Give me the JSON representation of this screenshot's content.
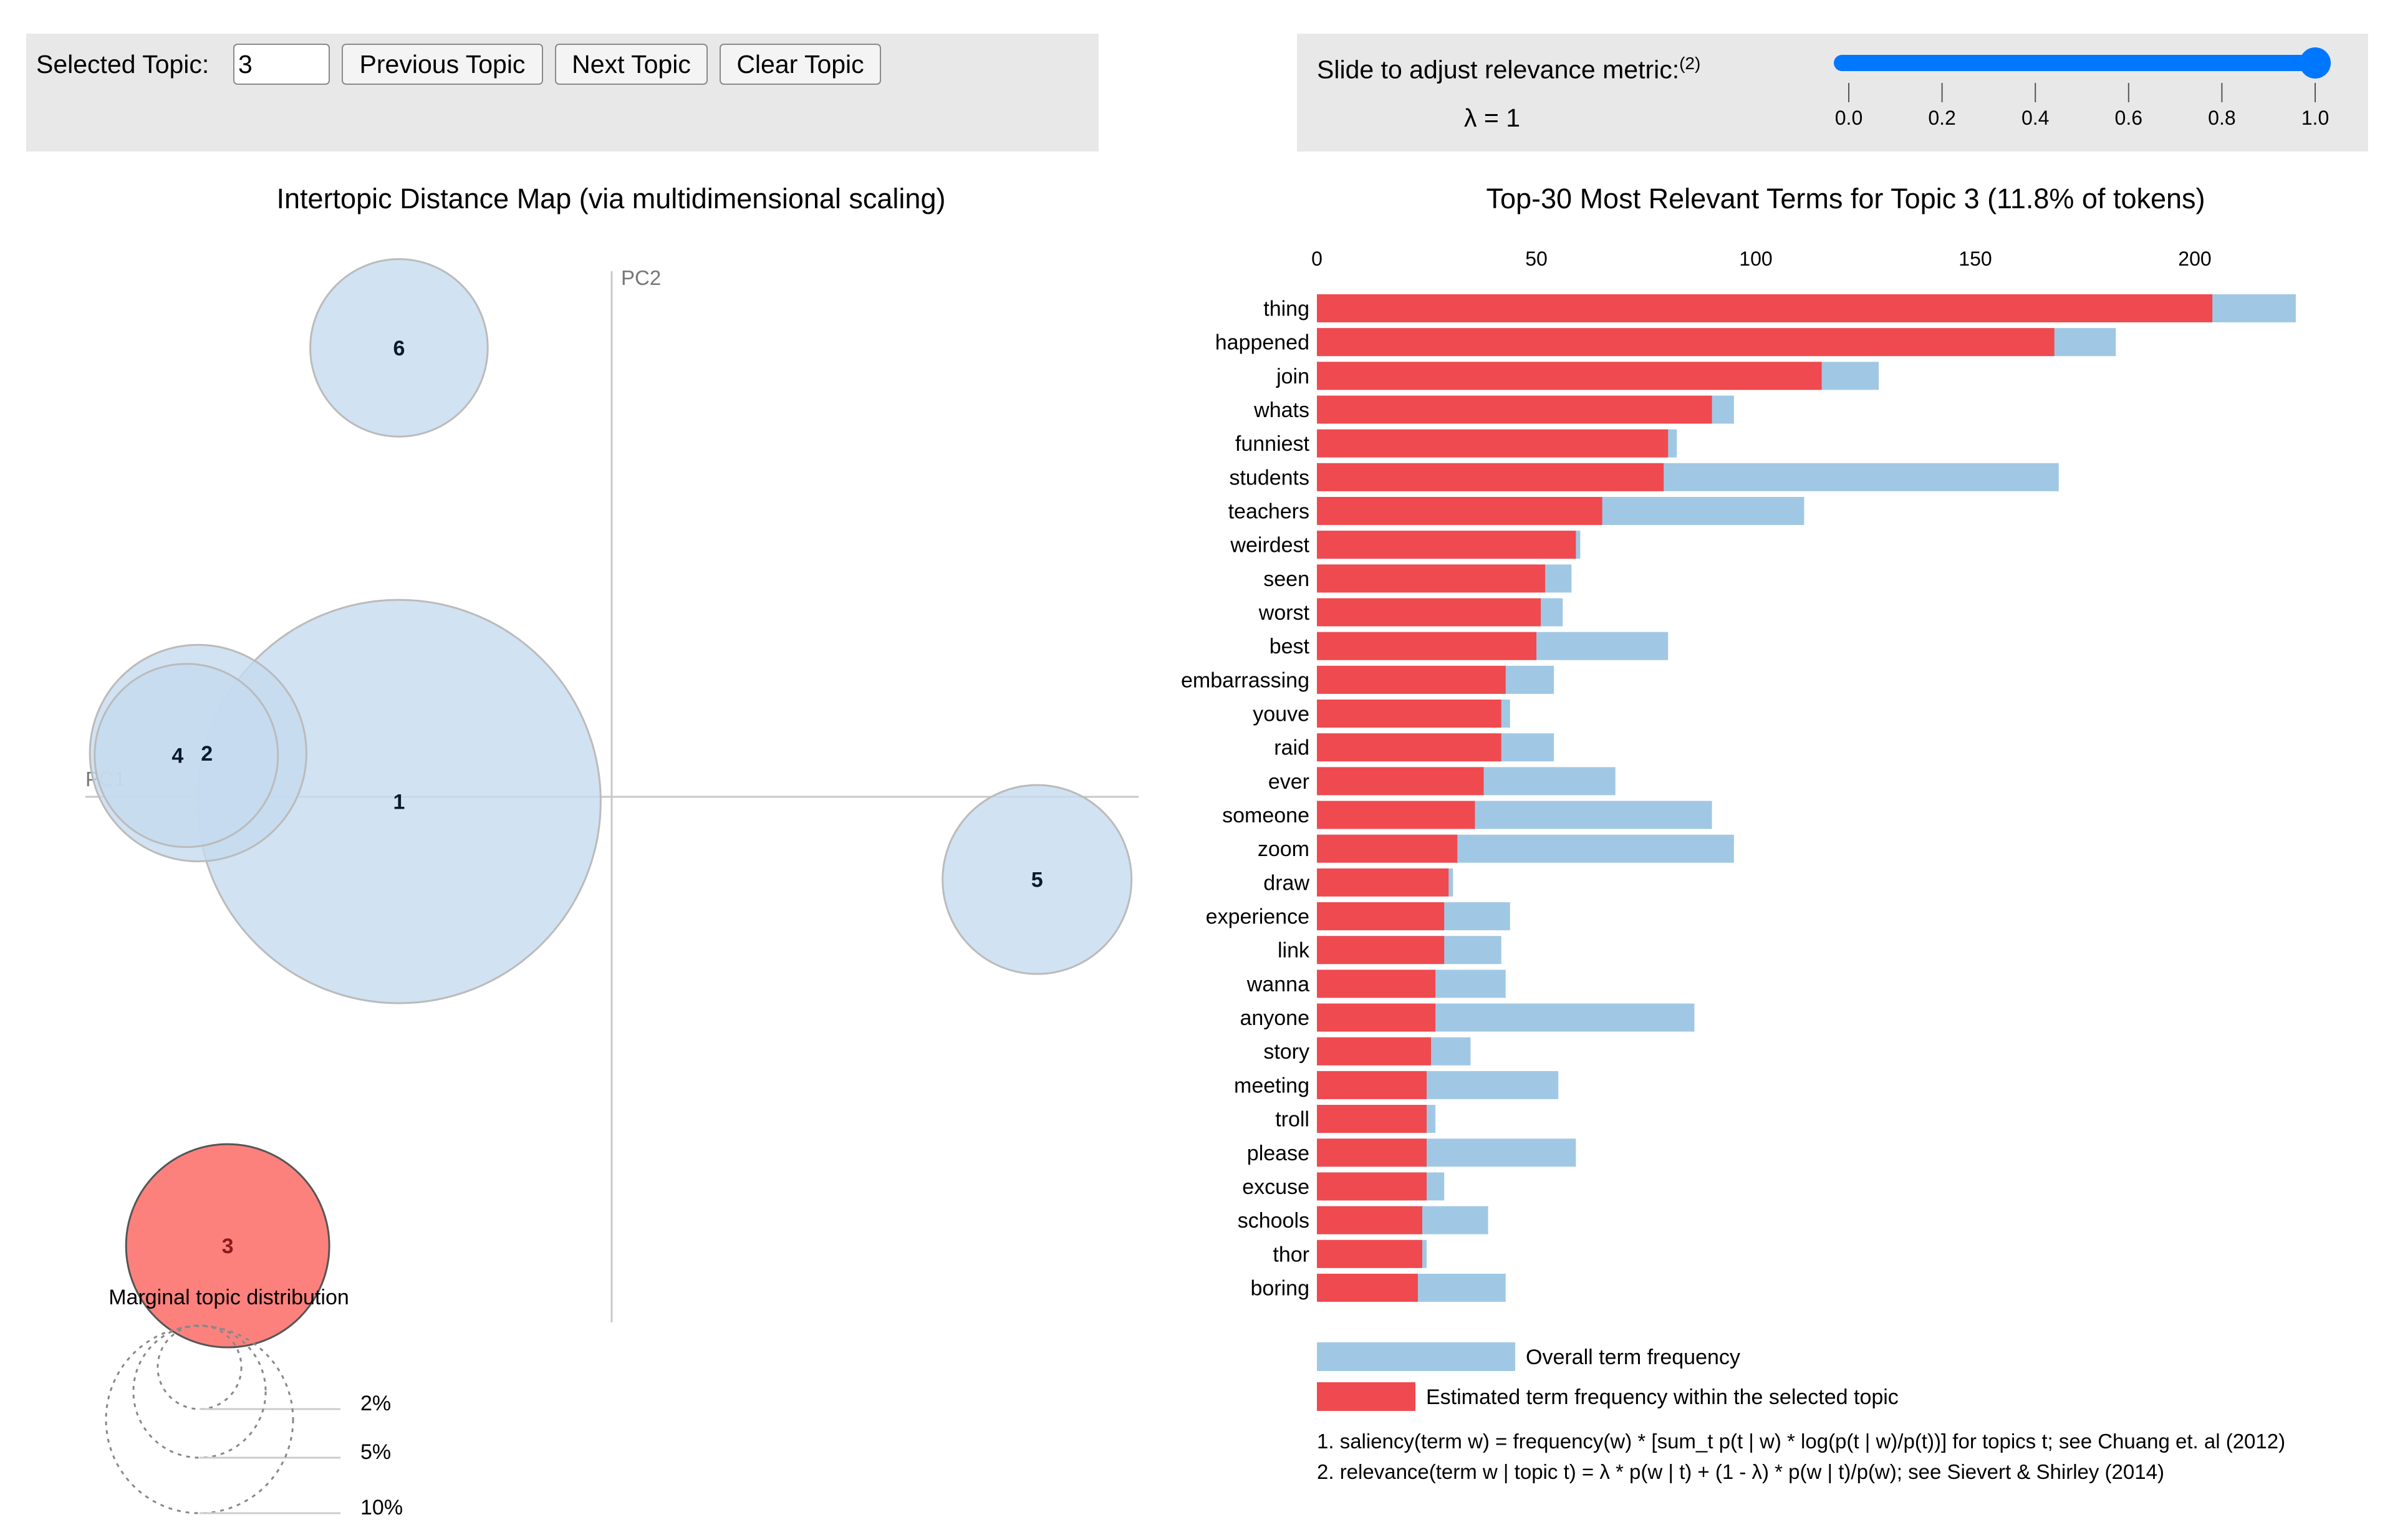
{
  "controls": {
    "selected_topic_label": "Selected Topic:",
    "selected_topic_value": "3",
    "previous_topic_label": "Previous Topic",
    "next_topic_label": "Next Topic",
    "clear_topic_label": "Clear Topic"
  },
  "relevance": {
    "label": "Slide to adjust relevance metric:",
    "footnote_ref": "(2)",
    "lambda_text": "λ = 1",
    "lambda_value": 1.0,
    "range": [
      0,
      1
    ],
    "ticks": [
      "0.0",
      "0.2",
      "0.4",
      "0.6",
      "0.8",
      "1.0"
    ],
    "accent_color": "#0077ff"
  },
  "chart_data": [
    {
      "type": "scatter",
      "title": "Intertopic Distance Map (via multidimensional scaling)",
      "xlabel": "PC1",
      "ylabel": "PC2",
      "bubble_size_meaning": "marginal topic distribution (% of tokens)",
      "selected_topic": "3",
      "topics": [
        {
          "id": "1",
          "pc1": -0.18,
          "pc2": -0.004,
          "percent": 46.5,
          "selected": false
        },
        {
          "id": "2",
          "pc1": -0.35,
          "pc2": 0.037,
          "percent": 13.4,
          "selected": false
        },
        {
          "id": "3",
          "pc1": -0.325,
          "pc2": -0.38,
          "percent": 11.8,
          "selected": true
        },
        {
          "id": "4",
          "pc1": -0.36,
          "pc2": 0.035,
          "percent": 9.6,
          "selected": false
        },
        {
          "id": "5",
          "pc1": 0.36,
          "pc2": -0.07,
          "percent": 10.2,
          "selected": false
        },
        {
          "id": "6",
          "pc1": -0.18,
          "pc2": 0.38,
          "percent": 9.0,
          "selected": false
        }
      ],
      "legend": {
        "title": "Marginal topic distribution",
        "sizes": [
          {
            "label": "2%",
            "value": 2
          },
          {
            "label": "5%",
            "value": 5
          },
          {
            "label": "10%",
            "value": 10
          }
        ]
      },
      "colors": {
        "topic": "#c6dbef",
        "selected": "#fc6b66"
      }
    },
    {
      "type": "bar",
      "orientation": "horizontal",
      "title": "Top-30 Most Relevant Terms for Topic 3 (11.8% of tokens)",
      "xlim": [
        0,
        225
      ],
      "xticks": [
        0,
        50,
        100,
        150,
        200
      ],
      "categories": [
        "thing",
        "happened",
        "join",
        "whats",
        "funniest",
        "students",
        "teachers",
        "weirdest",
        "seen",
        "worst",
        "best",
        "embarrassing",
        "youve",
        "raid",
        "ever",
        "someone",
        "zoom",
        "draw",
        "experience",
        "link",
        "wanna",
        "anyone",
        "story",
        "meeting",
        "troll",
        "please",
        "excuse",
        "schools",
        "thor",
        "boring"
      ],
      "series": [
        {
          "name": "Overall term frequency",
          "color": "#a0c8e4",
          "values": [
            223,
            182,
            128,
            95,
            82,
            169,
            111,
            60,
            58,
            56,
            80,
            54,
            44,
            54,
            68,
            90,
            95,
            31,
            44,
            42,
            43,
            86,
            35,
            55,
            27,
            59,
            29,
            39,
            25,
            43
          ]
        },
        {
          "name": "Estimated term frequency within the selected topic",
          "color": "#ef4a4f",
          "values": [
            204,
            168,
            115,
            90,
            80,
            79,
            65,
            59,
            52,
            51,
            50,
            43,
            42,
            42,
            38,
            36,
            32,
            30,
            29,
            29,
            27,
            27,
            26,
            25,
            25,
            25,
            25,
            24,
            24,
            23
          ]
        }
      ],
      "footnotes": [
        "1. saliency(term w) = frequency(w) * [sum_t p(t | w) * log(p(t | w)/p(t))] for topics t; see Chuang et. al (2012)",
        "2. relevance(term w | topic t) = λ * p(w | t) + (1 - λ) * p(w | t)/p(w); see Sievert & Shirley (2014)"
      ]
    }
  ]
}
